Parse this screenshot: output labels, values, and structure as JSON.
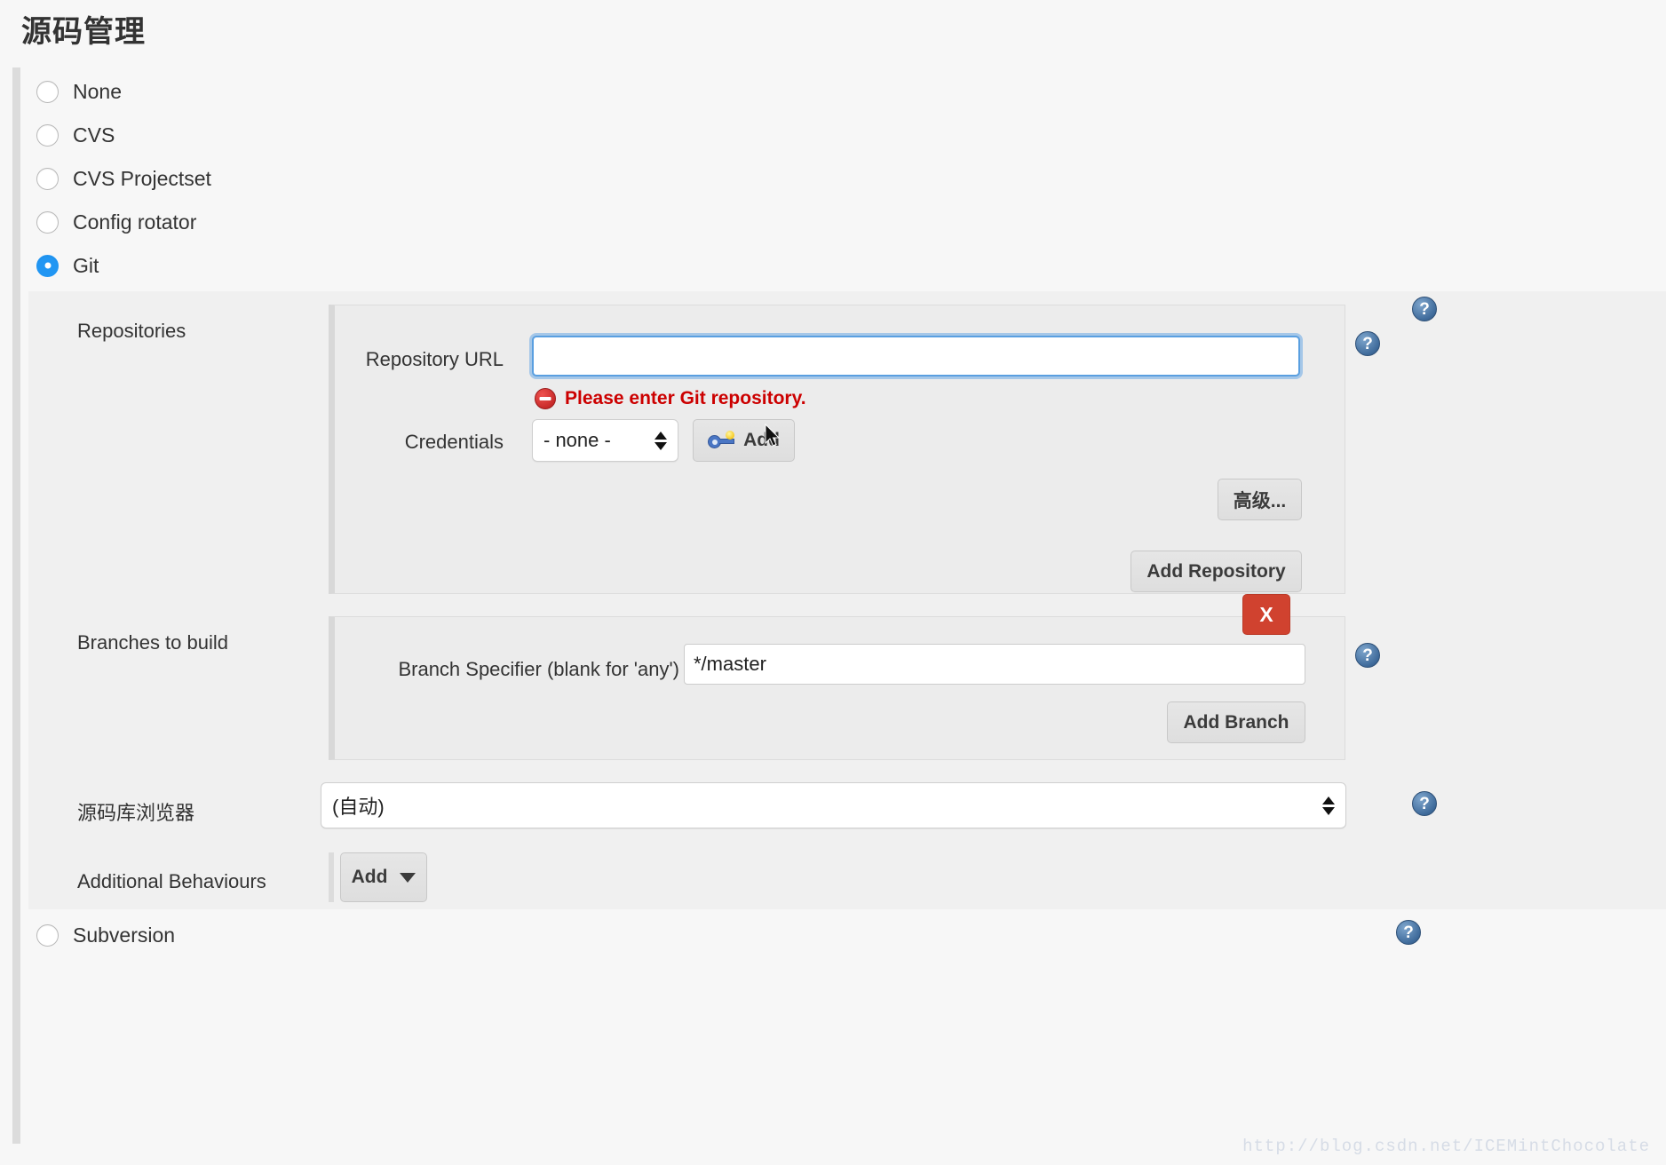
{
  "page": {
    "title": "源码管理",
    "watermark": "http://blog.csdn.net/ICEMintChocolate"
  },
  "scm_options": [
    {
      "label": "None",
      "selected": false
    },
    {
      "label": "CVS",
      "selected": false
    },
    {
      "label": "CVS Projectset",
      "selected": false
    },
    {
      "label": "Config rotator",
      "selected": false
    },
    {
      "label": "Git",
      "selected": true
    },
    {
      "label": "Subversion",
      "selected": false
    }
  ],
  "git": {
    "repositories": {
      "section_label": "Repositories",
      "repository_url": {
        "label": "Repository URL",
        "value": "",
        "placeholder": "",
        "focused": true,
        "error": "Please enter Git repository.",
        "error_icon": "error-stop-icon"
      },
      "credentials": {
        "label": "Credentials",
        "selected_option": "- none -",
        "options": [
          "- none -"
        ],
        "add_button": {
          "label": "Add",
          "icon": "key-icon"
        }
      },
      "advanced_button": "高级...",
      "add_repository_button": "Add Repository"
    },
    "branches": {
      "section_label": "Branches to build",
      "delete_button": "X",
      "branch_specifier": {
        "label": "Branch Specifier (blank for 'any')",
        "value": "*/master"
      },
      "add_branch_button": "Add Branch"
    },
    "repository_browser": {
      "label": "源码库浏览器",
      "selected_option": "(自动)",
      "options": [
        "(自动)"
      ]
    },
    "additional_behaviours": {
      "label": "Additional Behaviours",
      "add_button": "Add",
      "add_caret": "chevron-down-icon"
    }
  },
  "help_icons": {
    "glyph": "?",
    "name": "help-icon"
  },
  "colors": {
    "accent": "#2196f3",
    "error": "#cc0000",
    "delete": "#d0422f",
    "panel": "#f0f0f0",
    "box": "#ececec"
  }
}
